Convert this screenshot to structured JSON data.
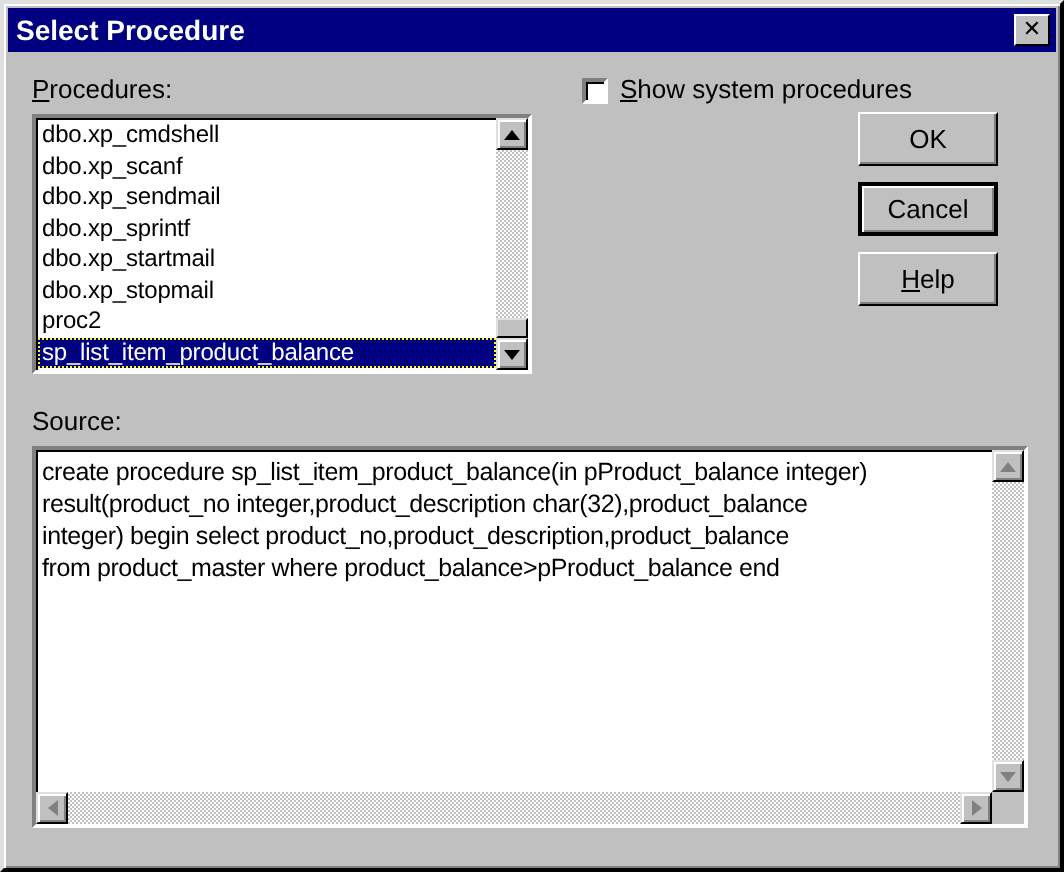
{
  "window": {
    "title": "Select Procedure",
    "close": "✕"
  },
  "procedures": {
    "label": "Procedures:",
    "items": [
      {
        "name": "dbo.xp_cmdshell",
        "selected": false
      },
      {
        "name": "dbo.xp_scanf",
        "selected": false
      },
      {
        "name": "dbo.xp_sendmail",
        "selected": false
      },
      {
        "name": "dbo.xp_sprintf",
        "selected": false
      },
      {
        "name": "dbo.xp_startmail",
        "selected": false
      },
      {
        "name": "dbo.xp_stopmail",
        "selected": false
      },
      {
        "name": "proc2",
        "selected": false
      },
      {
        "name": "sp_list_item_product_balance",
        "selected": true
      }
    ]
  },
  "show_system": {
    "label": "Show system procedures",
    "checked": false
  },
  "buttons": [
    {
      "label": "OK",
      "focused": false
    },
    {
      "label": "Cancel",
      "focused": true
    },
    {
      "label": "Help",
      "focused": false
    }
  ],
  "source": {
    "label": "Source:",
    "value": "create procedure sp_list_item_product_balance(in pProduct_balance integer)\nresult(product_no integer,product_description char(32),product_balance\ninteger) begin select product_no,product_description,product_balance\nfrom product_master where product_balance>pProduct_balance end"
  }
}
